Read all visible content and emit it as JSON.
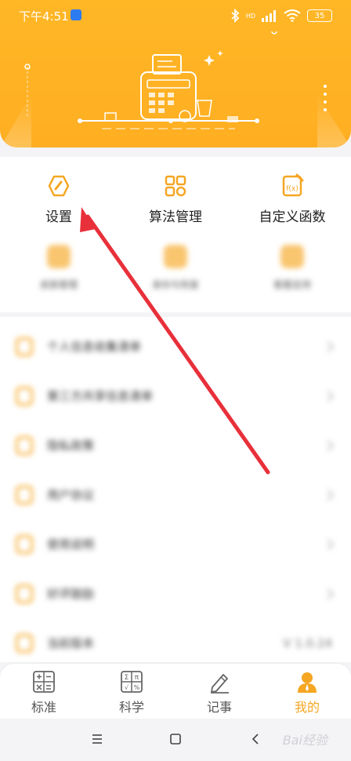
{
  "status": {
    "time": "下午4:51",
    "battery": "35",
    "bluetooth_badge": "bluetooth-icon",
    "signal": "HD"
  },
  "grid": {
    "items": [
      {
        "label": "设置",
        "icon": "hexagon-settings-icon"
      },
      {
        "label": "算法管理",
        "icon": "algorithm-grid-icon"
      },
      {
        "label": "自定义函数",
        "icon": "function-icon"
      }
    ],
    "blurred": [
      {
        "label": "皮肤管理"
      },
      {
        "label": "身份与恢复"
      },
      {
        "label": "客服支持"
      }
    ]
  },
  "list": {
    "items": [
      {
        "label": "个人信息收集清单",
        "right": ""
      },
      {
        "label": "第三方共享信息清单",
        "right": ""
      },
      {
        "label": "隐私政策",
        "right": ""
      },
      {
        "label": "用户协议",
        "right": ""
      },
      {
        "label": "使用说明",
        "right": ""
      },
      {
        "label": "好评鼓励",
        "right": ""
      },
      {
        "label": "当前版本",
        "right": "V 1.0.24"
      }
    ]
  },
  "tabs": [
    {
      "label": "标准",
      "icon": "standard-calc-icon",
      "active": false
    },
    {
      "label": "科学",
      "icon": "scientific-calc-icon",
      "active": false
    },
    {
      "label": "记事",
      "icon": "pencil-note-icon",
      "active": false
    },
    {
      "label": "我的",
      "icon": "user-profile-icon",
      "active": true
    }
  ],
  "navbar": {
    "watermark": "Bai经验"
  },
  "colors": {
    "accent": "#f5a623",
    "header": "#ffb726",
    "arrow": "#e8303a"
  }
}
